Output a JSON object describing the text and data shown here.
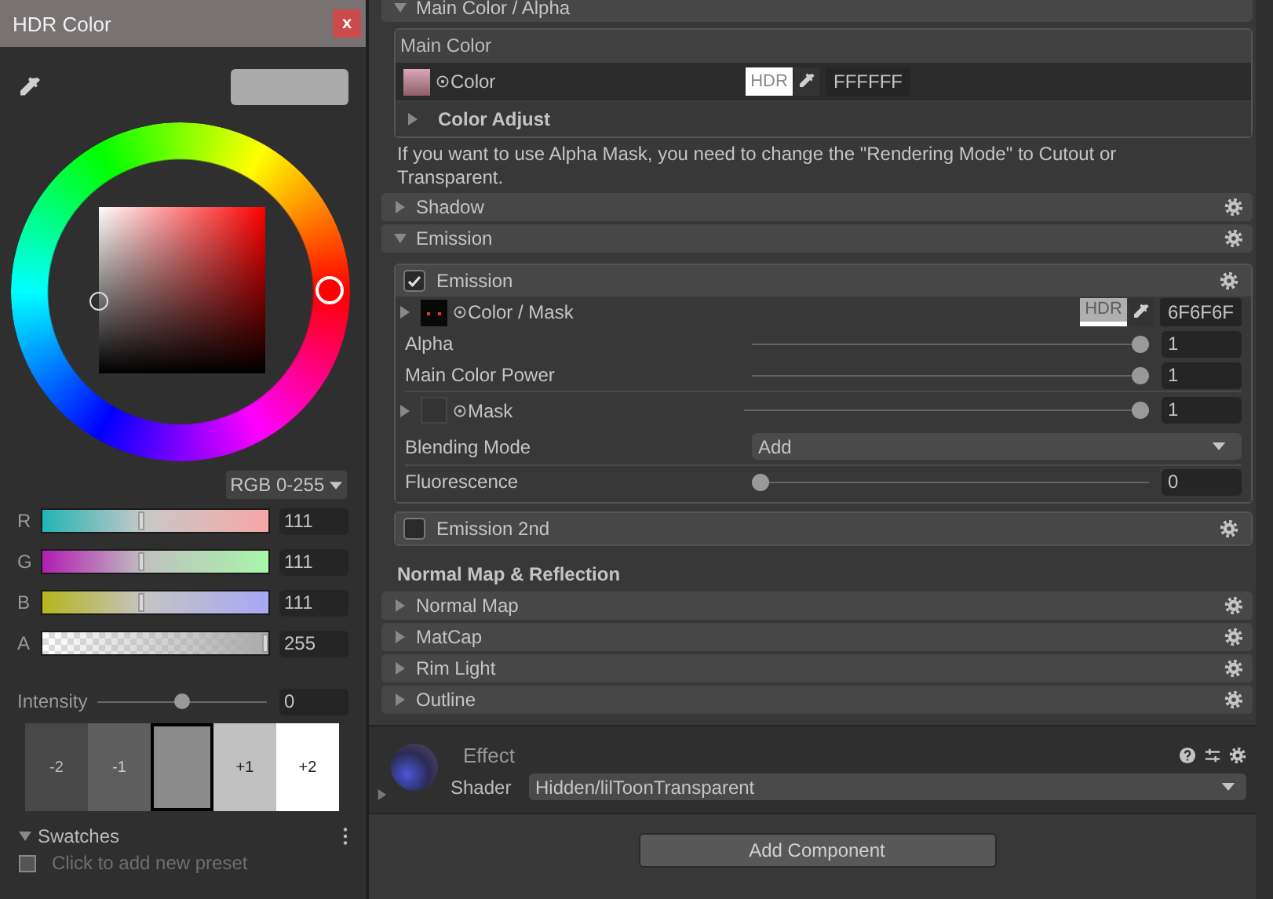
{
  "color_picker": {
    "title": "HDR Color",
    "close": "x",
    "mode": "RGB 0-255",
    "channels": [
      {
        "name": "R",
        "kind": "red",
        "level": 0.435,
        "value": "111"
      },
      {
        "name": "G",
        "kind": "green",
        "level": 0.435,
        "value": "111"
      },
      {
        "name": "B",
        "kind": "blue",
        "level": 0.435,
        "value": "111"
      },
      {
        "name": "A",
        "kind": "alpha",
        "level": 1,
        "value": "255"
      }
    ],
    "intensity": {
      "label": "Intensity",
      "level": 0.5,
      "value": "0"
    },
    "exposure": [
      {
        "label": "-2",
        "selected": false
      },
      {
        "label": "-1",
        "selected": false
      },
      {
        "selected": true
      },
      {
        "label": "+1",
        "selected": false
      },
      {
        "label": "+2",
        "selected": false
      }
    ],
    "swatches": {
      "title": "Swatches",
      "expanded": true,
      "hint": "Click to add new preset"
    }
  },
  "inspector": {
    "top_section": {
      "title": "Main Color / Alpha",
      "expanded": true
    },
    "main_color": {
      "title": "Main Color",
      "label": "Color",
      "hdr": "HDR",
      "hex": "FFFFFF",
      "adjust": {
        "title": "Color Adjust",
        "expanded": false
      }
    },
    "note": "If you want to use Alpha Mask, you need to change the \"Rendering Mode\" to Cutout or Transparent.",
    "sections": [
      {
        "title": "Shadow",
        "expanded": false
      },
      {
        "title": "Emission",
        "expanded": true
      }
    ],
    "emission": {
      "label": "Emission",
      "checked": true,
      "rows": [
        {
          "kind": "color",
          "label": "Color / Mask",
          "hdr": "HDR",
          "hex": "6F6F6F"
        },
        {
          "kind": "slider",
          "label": "Alpha",
          "level": 1,
          "value": "1"
        },
        {
          "kind": "slider",
          "label": "Main Color Power",
          "level": 1,
          "value": "1"
        },
        {
          "kind": "texture_slider",
          "label": "Mask",
          "level": 1,
          "value": "1"
        },
        {
          "kind": "dropdown",
          "label": "Blending Mode",
          "value": "Add"
        },
        {
          "kind": "slider",
          "label": "Fluorescence",
          "level": 0,
          "value": "0"
        }
      ]
    },
    "emission_2nd": {
      "label": "Emission 2nd",
      "checked": false
    },
    "group_title": "Normal Map & Reflection",
    "group_sections": [
      {
        "title": "Normal Map",
        "expanded": false
      },
      {
        "title": "MatCap",
        "expanded": false
      },
      {
        "title": "Rim Light",
        "expanded": false
      },
      {
        "title": "Outline",
        "expanded": false
      }
    ],
    "effect": {
      "name": "Effect",
      "shader_label": "Shader",
      "shader": "Hidden/lilToonTransparent"
    },
    "add_component": "Add Component"
  }
}
